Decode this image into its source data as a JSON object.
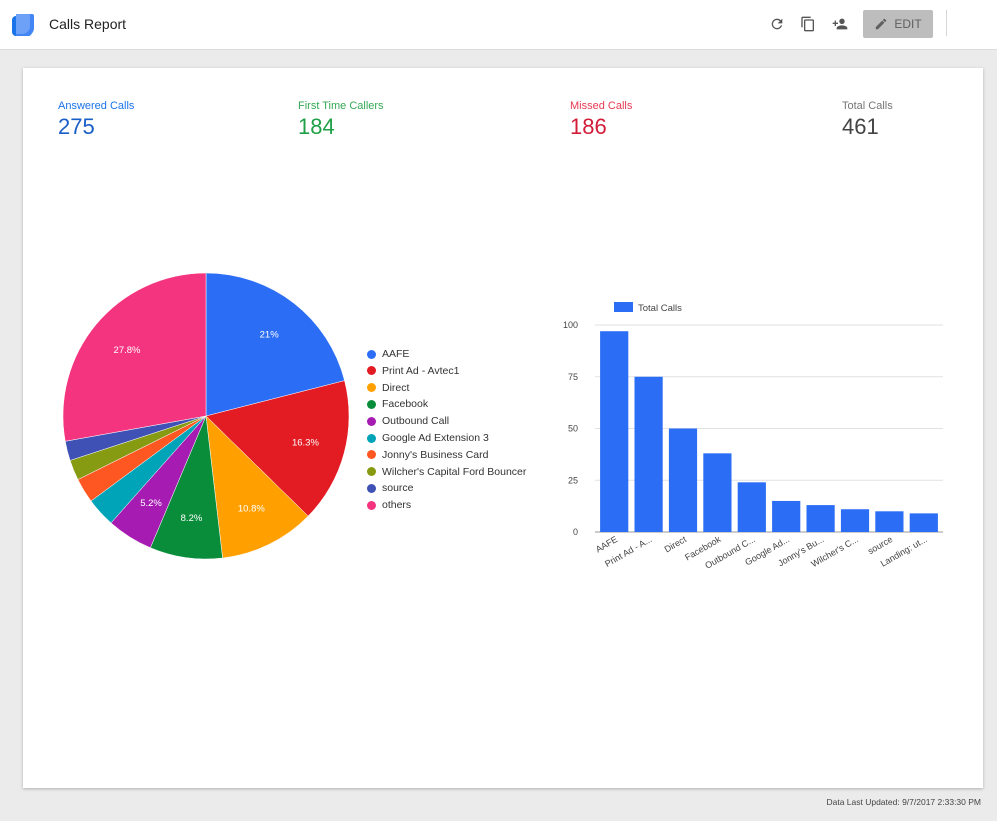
{
  "header": {
    "title": "Calls Report",
    "edit_label": "EDIT",
    "icons": [
      "refresh-icon",
      "copy-icon",
      "add-person-icon",
      "pencil-icon"
    ]
  },
  "metrics": [
    {
      "label": "Answered Calls",
      "value": "275",
      "color": "#1a5fc7"
    },
    {
      "label": "First Time Callers",
      "value": "184",
      "color": "#20a046"
    },
    {
      "label": "Missed Calls",
      "value": "186",
      "color": "#d21c3a"
    },
    {
      "label": "Total Calls",
      "value": "461",
      "color": "#757575"
    }
  ],
  "footer": {
    "last_updated": "Data Last Updated: 9/7/2017 2:33:30 PM"
  },
  "chart_data": [
    {
      "type": "pie",
      "labels": [
        "AAFE",
        "Print Ad - Avtec1",
        "Direct",
        "Facebook",
        "Outbound Call",
        "Google Ad Extension 3",
        "Jonny's Business Card",
        "Wilcher's Capital Ford Bouncer",
        "source",
        "others"
      ],
      "values": [
        21,
        16.3,
        10.8,
        8.2,
        5.2,
        3.3,
        2.8,
        2.3,
        2.2,
        27.8
      ],
      "data_labels": [
        "21%",
        "16.3%",
        "10.8%",
        "8.2%",
        "5.2%",
        "",
        "",
        "",
        "",
        "27.8%"
      ],
      "colors": [
        "#2b6ef5",
        "#e31b23",
        "#ffa000",
        "#0a8d3b",
        "#a61cb3",
        "#00a4b8",
        "#ff5722",
        "#869a12",
        "#3f51b5",
        "#f5347f"
      ],
      "legend": "right"
    },
    {
      "type": "bar",
      "categories": [
        "AAFE",
        "Print Ad - A...",
        "Direct",
        "Facebook",
        "Outbound C...",
        "Google Ad...",
        "Jonny's Bu...",
        "Wilcher's C...",
        "source",
        "Landing: ut..."
      ],
      "series": [
        {
          "name": "Total Calls",
          "values": [
            97,
            75,
            50,
            38,
            24,
            15,
            13,
            11,
            10,
            9
          ],
          "color": "#2b6ef5"
        }
      ],
      "ylim": [
        0,
        100
      ],
      "yticks": [
        "0",
        "25",
        "50",
        "75",
        "100"
      ],
      "grid": true,
      "legend": "top-left"
    }
  ]
}
